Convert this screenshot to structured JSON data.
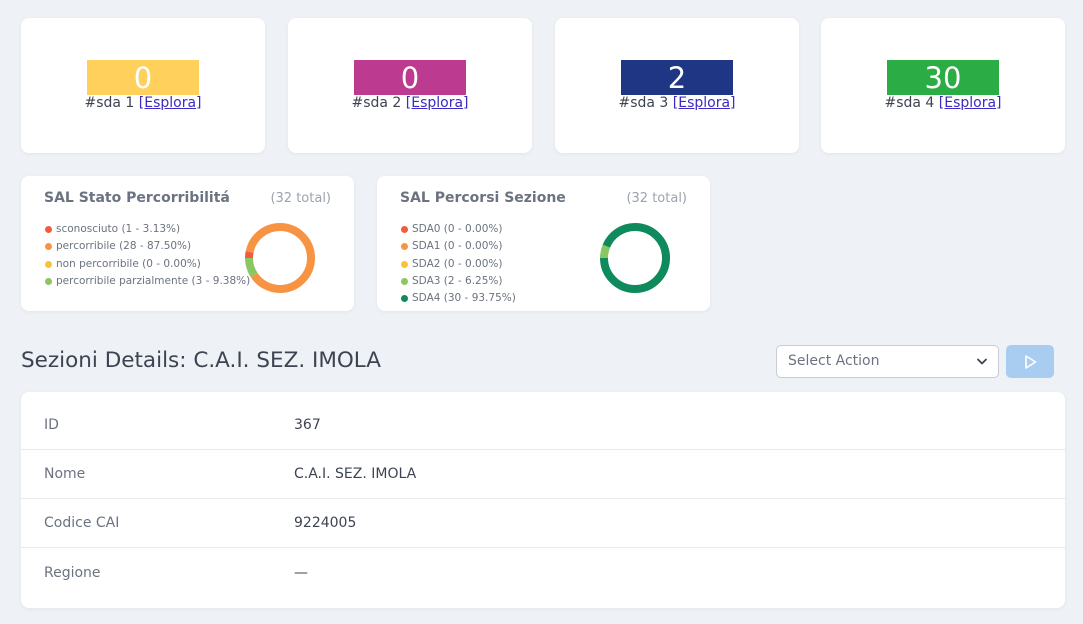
{
  "stats": [
    {
      "value": "0",
      "label": "#sda 1",
      "link": "[Esplora]",
      "color": "#ffd05c"
    },
    {
      "value": "0",
      "label": "#sda 2",
      "link": "[Esplora]",
      "color": "#bc3a8f"
    },
    {
      "value": "2",
      "label": "#sda 3",
      "link": "[Esplora]",
      "color": "#1f3684"
    },
    {
      "value": "30",
      "label": "#sda 4",
      "link": "[Esplora]",
      "color": "#2bac45"
    }
  ],
  "charts": [
    {
      "title": "SAL Stato Percorribilitá",
      "total": "(32 total)",
      "legend": [
        {
          "label": "sconosciuto (1 - 3.13%)",
          "color": "#f35b3f"
        },
        {
          "label": "percorribile (28 - 87.50%)",
          "color": "#f79443"
        },
        {
          "label": "non percorribile (0 - 0.00%)",
          "color": "#f8c23a"
        },
        {
          "label": "percorribile parzialmente (3 - 9.38%)",
          "color": "#8ac661"
        }
      ]
    },
    {
      "title": "SAL Percorsi Sezione",
      "total": "(32 total)",
      "legend": [
        {
          "label": "SDA0 (0 - 0.00%)",
          "color": "#f35b3f"
        },
        {
          "label": "SDA1 (0 - 0.00%)",
          "color": "#f79443"
        },
        {
          "label": "SDA2 (0 - 0.00%)",
          "color": "#f8c23a"
        },
        {
          "label": "SDA3 (2 - 6.25%)",
          "color": "#8ac661"
        },
        {
          "label": "SDA4 (30 - 93.75%)",
          "color": "#0e8a5c"
        }
      ]
    }
  ],
  "chart_data": [
    {
      "type": "pie",
      "title": "SAL Stato Percorribilitá",
      "categories": [
        "sconosciuto",
        "percorribile",
        "non percorribile",
        "percorribile parzialmente"
      ],
      "values": [
        1,
        28,
        0,
        3
      ],
      "colors": [
        "#f35b3f",
        "#f79443",
        "#f8c23a",
        "#8ac661"
      ],
      "legend": "left"
    },
    {
      "type": "pie",
      "title": "SAL Percorsi Sezione",
      "categories": [
        "SDA0",
        "SDA1",
        "SDA2",
        "SDA3",
        "SDA4"
      ],
      "values": [
        0,
        0,
        0,
        2,
        30
      ],
      "colors": [
        "#f35b3f",
        "#f79443",
        "#f8c23a",
        "#8ac661",
        "#0e8a5c"
      ],
      "legend": "left"
    }
  ],
  "details": {
    "title": "Sezioni Details: C.A.I. SEZ. IMOLA",
    "select_placeholder": "Select Action",
    "rows": [
      {
        "key": "ID",
        "value": "367"
      },
      {
        "key": "Nome",
        "value": "C.A.I. SEZ. IMOLA"
      },
      {
        "key": "Codice CAI",
        "value": "9224005"
      },
      {
        "key": "Regione",
        "value": "—"
      }
    ]
  }
}
